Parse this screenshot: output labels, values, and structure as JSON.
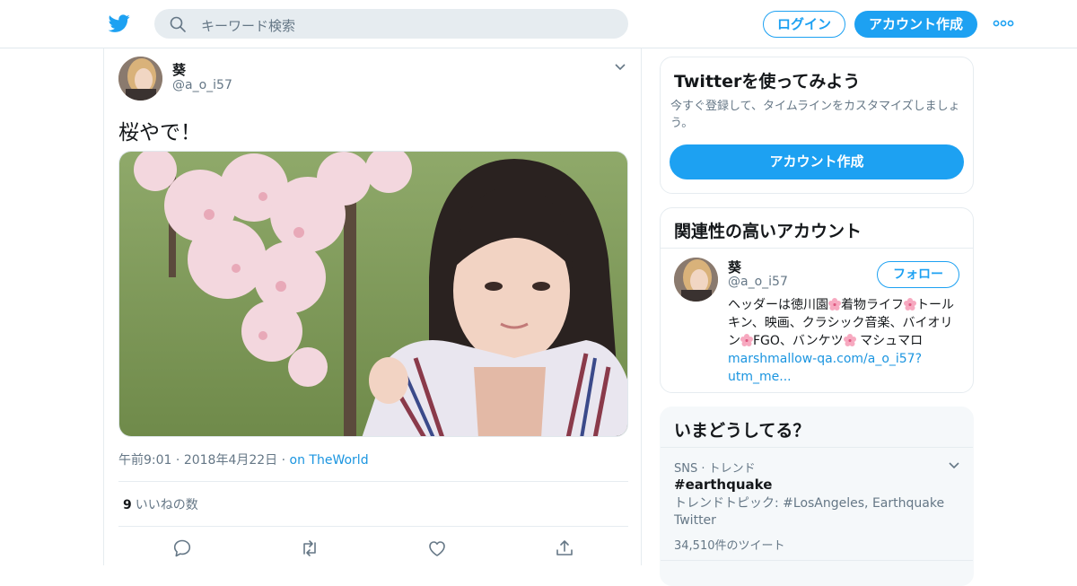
{
  "header": {
    "search_placeholder": "キーワード検索",
    "login_label": "ログイン",
    "signup_label": "アカウント作成"
  },
  "tweet": {
    "author_name": "葵",
    "author_handle": "@a_o_i57",
    "text": "桜やで！",
    "time": "午前9:01",
    "date": "2018年4月22日",
    "via": "on TheWorld",
    "likes_count": "9",
    "likes_label": "いいねの数"
  },
  "signup_card": {
    "title": "Twitterを使ってみよう",
    "description": "今すぐ登録して、タイムラインをカスタマイズしましょう。",
    "button_label": "アカウント作成"
  },
  "related": {
    "title": "関連性の高いアカウント",
    "name": "葵",
    "handle": "@a_o_i57",
    "follow_label": "フォロー",
    "bio_1": "ヘッダーは徳川園",
    "bio_2": "着物ライフ",
    "bio_3": "トールキン、映画、クラシック音楽、バイオリン",
    "bio_4": "FGO、バンケツ",
    "bio_5": " マシュマロ",
    "bio_link": "marshmallow-qa.com/a_o_i57?utm_me..."
  },
  "trends": {
    "title": "いまどうしてる？",
    "category": "SNS · トレンド",
    "hashtag": "#earthquake",
    "topic": "トレンドトピック: #LosAngeles, Earthquake Twitter",
    "count": "34,510件のツイート"
  },
  "colors": {
    "accent": "#1da1f2",
    "link": "#1b95e0",
    "muted": "#657786"
  }
}
